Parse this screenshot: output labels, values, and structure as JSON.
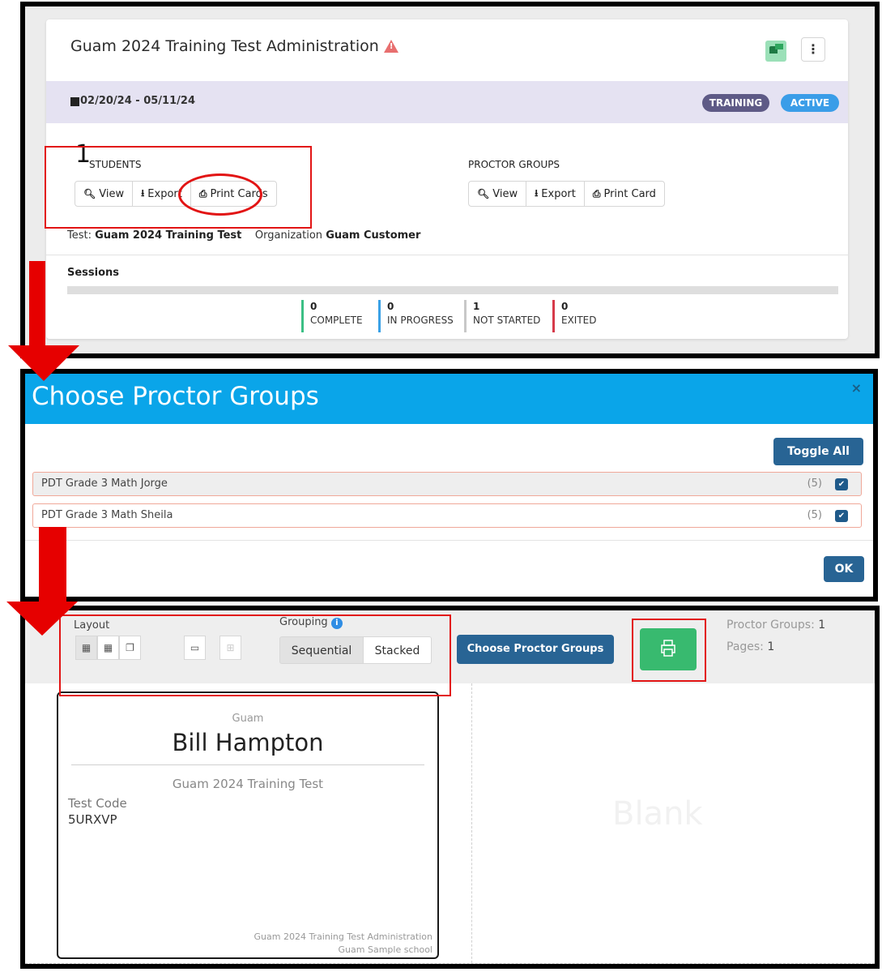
{
  "admin_card": {
    "title": "Guam 2024 Training Test Administration",
    "date_range": "02/20/24 - 05/11/24",
    "badges": {
      "training": "TRAINING",
      "active": "ACTIVE"
    },
    "students": {
      "count": "1",
      "label": "STUDENTS",
      "buttons": {
        "view": "View",
        "export": "Export",
        "print": "Print Cards"
      }
    },
    "proctor_groups": {
      "label": "PROCTOR GROUPS",
      "buttons": {
        "view": "View",
        "export": "Export",
        "print": "Print Card"
      }
    },
    "meta": {
      "test_label": "Test:",
      "test_value": "Guam 2024 Training Test",
      "org_label": "Organization",
      "org_value": "Guam Customer"
    },
    "sessions": {
      "label": "Sessions",
      "stats": [
        {
          "count": "0",
          "label": "COMPLETE",
          "color": "#3bbf85"
        },
        {
          "count": "0",
          "label": "IN PROGRESS",
          "color": "#3aa1e6"
        },
        {
          "count": "1",
          "label": "NOT STARTED",
          "color": "#c8c8c8"
        },
        {
          "count": "0",
          "label": "EXITED",
          "color": "#d63a4a"
        }
      ]
    }
  },
  "modal": {
    "title": "Choose Proctor Groups",
    "close": "×",
    "toggle_all": "Toggle All",
    "groups": [
      {
        "name": "PDT Grade 3 Math Jorge",
        "count": "(5)",
        "checked": true
      },
      {
        "name": "PDT Grade 3 Math Sheila",
        "count": "(5)",
        "checked": true
      }
    ],
    "ok": "OK"
  },
  "print_view": {
    "layout_label": "Layout",
    "grouping_label": "Grouping",
    "grouping_options": [
      "Sequential",
      "Stacked"
    ],
    "choose_button": "Choose Proctor Groups",
    "proctor_groups_label": "Proctor Groups:",
    "proctor_groups_count": "1",
    "pages_label": "Pages:",
    "pages_count": "1",
    "card": {
      "org": "Guam",
      "student": "Bill Hampton",
      "test": "Guam 2024 Training Test",
      "code_label": "Test Code",
      "code": "5URXVP",
      "footer_admin": "Guam 2024 Training Test Administration",
      "footer_school": "Guam Sample school"
    },
    "blank_label": "Blank"
  },
  "colors": {
    "annotation_red": "#e21414",
    "modal_header": "#0aa5e9",
    "primary_button": "#286494",
    "print_button": "#38ba6f"
  }
}
